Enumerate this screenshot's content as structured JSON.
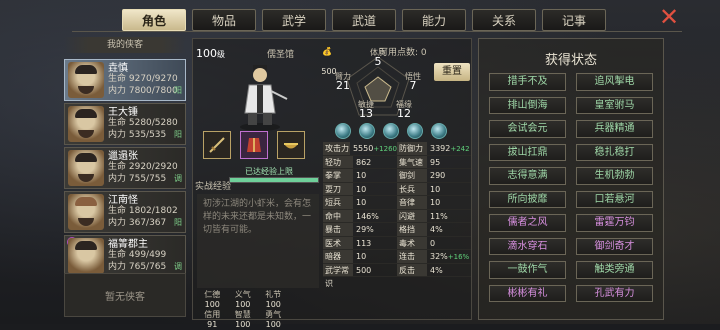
{
  "tabs": [
    "角色",
    "物品",
    "武学",
    "武道",
    "能力",
    "关系",
    "记事"
  ],
  "left": {
    "title": "我的侠客",
    "heroes": [
      {
        "name": "垚慎",
        "hp": "生命 9270/9270",
        "mp": "内力 7800/7800",
        "tag": "阳"
      },
      {
        "name": "王大锤",
        "hp": "生命 5280/5280",
        "mp": "内力 535/535",
        "tag": "阳"
      },
      {
        "name": "邋遢张",
        "hp": "生命 2920/2920",
        "mp": "内力 755/755",
        "tag": "调"
      },
      {
        "name": "江南怪",
        "hp": "生命 1802/1802",
        "mp": "内力 367/367",
        "tag": "阳"
      },
      {
        "name": "福箐郡主",
        "hp": "生命 499/499",
        "mp": "内力 765/765",
        "tag": "调"
      }
    ],
    "empty_label": "暂无侠客"
  },
  "character": {
    "level": "100",
    "level_unit": "级",
    "school": "儒圣馆",
    "wealth": "500",
    "points": "可用点数: 0",
    "reset": "重置",
    "exp_label": "实战经验",
    "exp_note": "已达经验上限",
    "exp_progress": 1.0,
    "description": "初涉江湖的小虾米，会有怎样的未来还都是未知数，一切皆有可能。",
    "virtues": [
      {
        "name": "仁德",
        "value": "100"
      },
      {
        "name": "义气",
        "value": "100"
      },
      {
        "name": "礼节",
        "value": "100"
      },
      {
        "name": "",
        "value": ""
      },
      {
        "name": "信用",
        "value": "91"
      },
      {
        "name": "智慧",
        "value": "100"
      },
      {
        "name": "勇气",
        "value": "100"
      },
      {
        "name": "",
        "value": ""
      }
    ]
  },
  "attributes": {
    "tizhi": {
      "label": "体质",
      "value": "5"
    },
    "wuxing": {
      "label": "悟性",
      "value": "7"
    },
    "fuyuan": {
      "label": "福缘",
      "value": "12"
    },
    "minjie": {
      "label": "敏捷",
      "value": "13"
    },
    "bili": {
      "label": "臂力",
      "value": "21"
    }
  },
  "stats": [
    [
      {
        "k": "攻击力",
        "v": "5550",
        "b": "+1260"
      },
      {
        "k": "防御力",
        "v": "3392",
        "b": "+242"
      }
    ],
    [
      {
        "k": "轻功",
        "v": "862",
        "b": ""
      },
      {
        "k": "集气速度",
        "v": "95",
        "b": ""
      }
    ],
    [
      {
        "k": "拳掌",
        "v": "10",
        "b": ""
      },
      {
        "k": "御剑",
        "v": "290",
        "b": ""
      }
    ],
    [
      {
        "k": "耍刀",
        "v": "10",
        "b": ""
      },
      {
        "k": "长兵",
        "v": "10",
        "b": ""
      }
    ],
    [
      {
        "k": "短兵",
        "v": "10",
        "b": ""
      },
      {
        "k": "音律",
        "v": "10",
        "b": ""
      }
    ],
    [
      {
        "k": "命中",
        "v": "146%",
        "b": ""
      },
      {
        "k": "闪避",
        "v": "11%",
        "b": ""
      }
    ],
    [
      {
        "k": "暴击",
        "v": "29%",
        "b": ""
      },
      {
        "k": "格挡",
        "v": "4%",
        "b": ""
      }
    ],
    [
      {
        "k": "医术",
        "v": "113",
        "b": ""
      },
      {
        "k": "毒术",
        "v": "0",
        "b": ""
      }
    ],
    [
      {
        "k": "暗器",
        "v": "10",
        "b": ""
      },
      {
        "k": "连击",
        "v": "32%",
        "b": "+16%"
      }
    ],
    [
      {
        "k": "武学常识",
        "v": "500",
        "b": ""
      },
      {
        "k": "反击",
        "v": "4%",
        "b": ""
      }
    ]
  ],
  "right": {
    "title": "获得状态",
    "statuses": [
      {
        "label": "措手不及",
        "color": "green"
      },
      {
        "label": "追风掣电",
        "color": "green"
      },
      {
        "label": "排山倒海",
        "color": "green"
      },
      {
        "label": "皇室驸马",
        "color": "green"
      },
      {
        "label": "会试会元",
        "color": "green"
      },
      {
        "label": "兵器精通",
        "color": "green"
      },
      {
        "label": "拔山扛鼎",
        "color": "green"
      },
      {
        "label": "稳扎稳打",
        "color": "green"
      },
      {
        "label": "志得意满",
        "color": "green"
      },
      {
        "label": "生机勃勃",
        "color": "green"
      },
      {
        "label": "所向披靡",
        "color": "green"
      },
      {
        "label": "口若悬河",
        "color": "green"
      },
      {
        "label": "儒者之风",
        "color": "purple"
      },
      {
        "label": "雷霆万钧",
        "color": "purple"
      },
      {
        "label": "滴水穿石",
        "color": "purple"
      },
      {
        "label": "御剑奇才",
        "color": "purple"
      },
      {
        "label": "一鼓作气",
        "color": "green"
      },
      {
        "label": "触类旁通",
        "color": "green"
      },
      {
        "label": "彬彬有礼",
        "color": "purple"
      },
      {
        "label": "孔武有力",
        "color": "purple"
      }
    ]
  }
}
